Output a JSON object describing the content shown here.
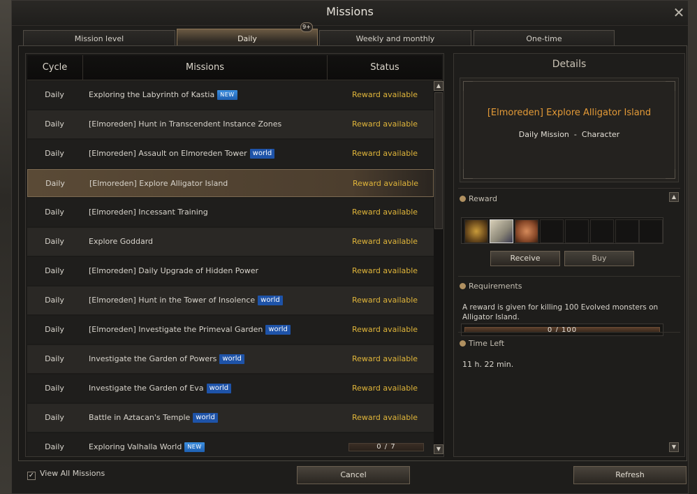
{
  "window": {
    "title": "Missions",
    "close_glyph": "✕"
  },
  "tabs": [
    {
      "label": "Mission level"
    },
    {
      "label": "Daily",
      "badge": "9+"
    },
    {
      "label": "Weekly and monthly"
    },
    {
      "label": "One-time"
    }
  ],
  "table": {
    "headers": {
      "cycle": "Cycle",
      "missions": "Missions",
      "status": "Status"
    },
    "rows": [
      {
        "cycle": "Daily",
        "name": "Exploring the Labyrinth of Kastia",
        "tag": "NEW",
        "status": "Reward available"
      },
      {
        "cycle": "Daily",
        "name": "[Elmoreden] Hunt in Transcendent Instance Zones",
        "tag": "",
        "status": "Reward available"
      },
      {
        "cycle": "Daily",
        "name": "[Elmoreden] Assault on Elmoreden Tower",
        "tag": "world",
        "status": "Reward available"
      },
      {
        "cycle": "Daily",
        "name": "[Elmoreden] Explore Alligator Island",
        "tag": "",
        "status": "Reward available",
        "selected": true
      },
      {
        "cycle": "Daily",
        "name": "[Elmoreden] Incessant Training",
        "tag": "",
        "status": "Reward available"
      },
      {
        "cycle": "Daily",
        "name": "Explore Goddard",
        "tag": "",
        "status": "Reward available"
      },
      {
        "cycle": "Daily",
        "name": "[Elmoreden] Daily Upgrade of Hidden Power",
        "tag": "",
        "status": "Reward available"
      },
      {
        "cycle": "Daily",
        "name": "[Elmoreden] Hunt in the Tower of Insolence",
        "tag": "world",
        "status": "Reward available"
      },
      {
        "cycle": "Daily",
        "name": "[Elmoreden] Investigate the Primeval Garden",
        "tag": "world",
        "status": "Reward available"
      },
      {
        "cycle": "Daily",
        "name": "Investigate the Garden of Powers",
        "tag": "world",
        "status": "Reward available"
      },
      {
        "cycle": "Daily",
        "name": "Investigate the Garden of Eva",
        "tag": "world",
        "status": "Reward available"
      },
      {
        "cycle": "Daily",
        "name": "Battle in Aztacan's Temple",
        "tag": "world",
        "status": "Reward available"
      },
      {
        "cycle": "Daily",
        "name": "Exploring Valhalla World",
        "tag": "NEW",
        "status": "",
        "progress": "0 / 7"
      }
    ]
  },
  "details": {
    "header": "Details",
    "title": "[Elmoreden] Explore Alligator Island",
    "type": "Daily Mission",
    "separator": "-",
    "scope": "Character",
    "reward_label": "Reward",
    "reward_items": [
      "reward-item-weapon-icon",
      "reward-item-scroll-icon",
      "reward-item-coin-icon"
    ],
    "receive_label": "Receive",
    "buy_label": "Buy",
    "requirements_label": "Requirements",
    "requirements_text": "A reward is given for killing 100 Evolved monsters on Alligator Island.",
    "progress": "0 / 100",
    "time_left_label": "Time Left",
    "time_left_value": "11 h. 22 min."
  },
  "footer": {
    "view_all_label": "View All Missions",
    "view_all_checked": true,
    "cancel_label": "Cancel",
    "refresh_label": "Refresh"
  },
  "colors": {
    "status_yellow": "#e0b53a",
    "detail_title_orange": "#e39a37",
    "tag_blue": "#1e53a8"
  }
}
